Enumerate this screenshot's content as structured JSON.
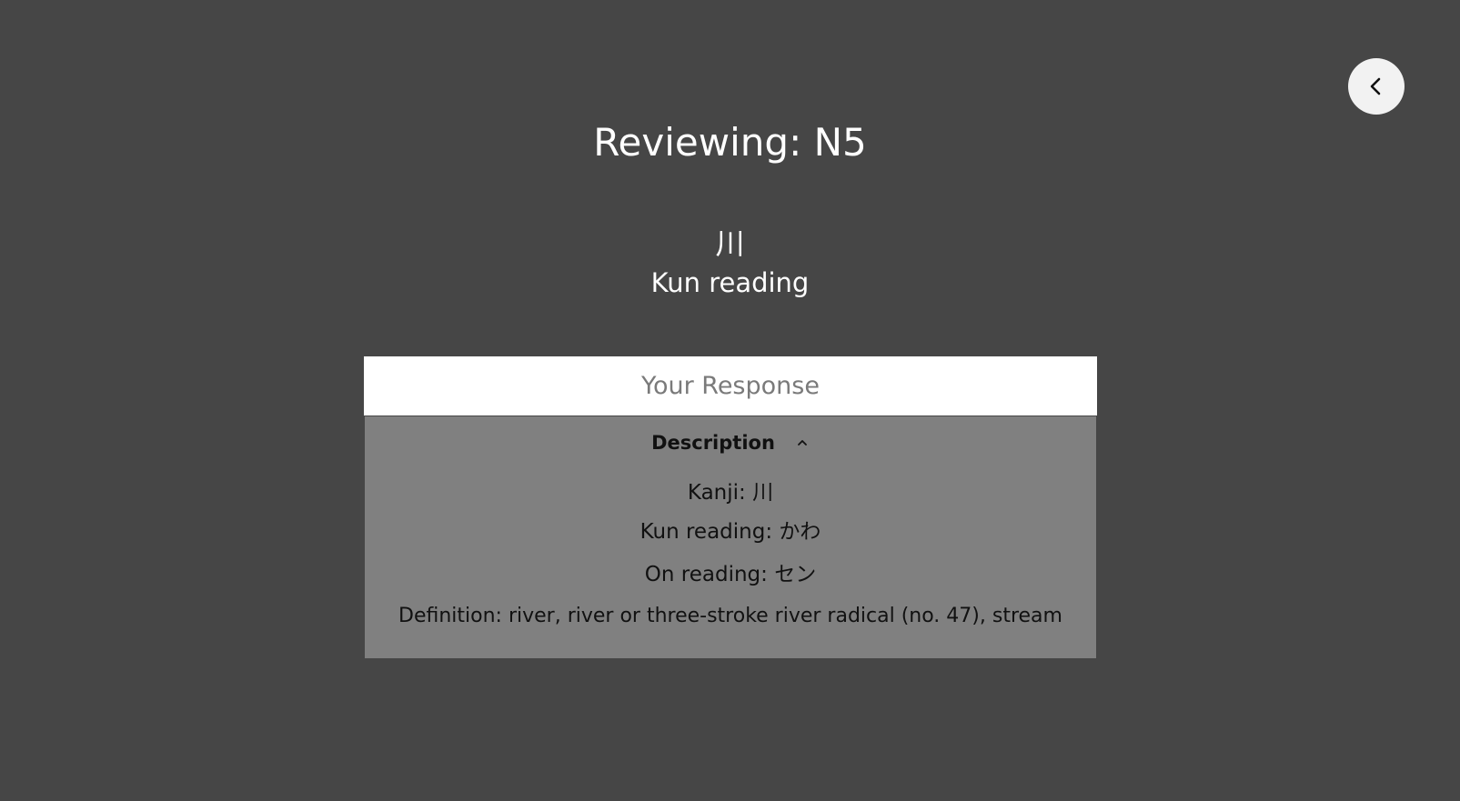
{
  "back_button": {
    "icon": "chevron-left-icon"
  },
  "header": {
    "title": "Reviewing: N5"
  },
  "card": {
    "kanji": "川",
    "prompt": "Kun reading"
  },
  "response": {
    "placeholder": "Your Response",
    "value": ""
  },
  "description": {
    "title": "Description",
    "toggle_icon": "caret-up-icon",
    "kanji_line": "Kanji: 川",
    "kun_line": "Kun reading: かわ",
    "on_line": "On reading: セン",
    "definition_line": "Definition: river, river or three-stroke river radical (no. 47), stream"
  },
  "colors": {
    "background": "#464646",
    "panel": "#808080",
    "input": "#ffffff",
    "back_button": "#f2f2f2"
  }
}
